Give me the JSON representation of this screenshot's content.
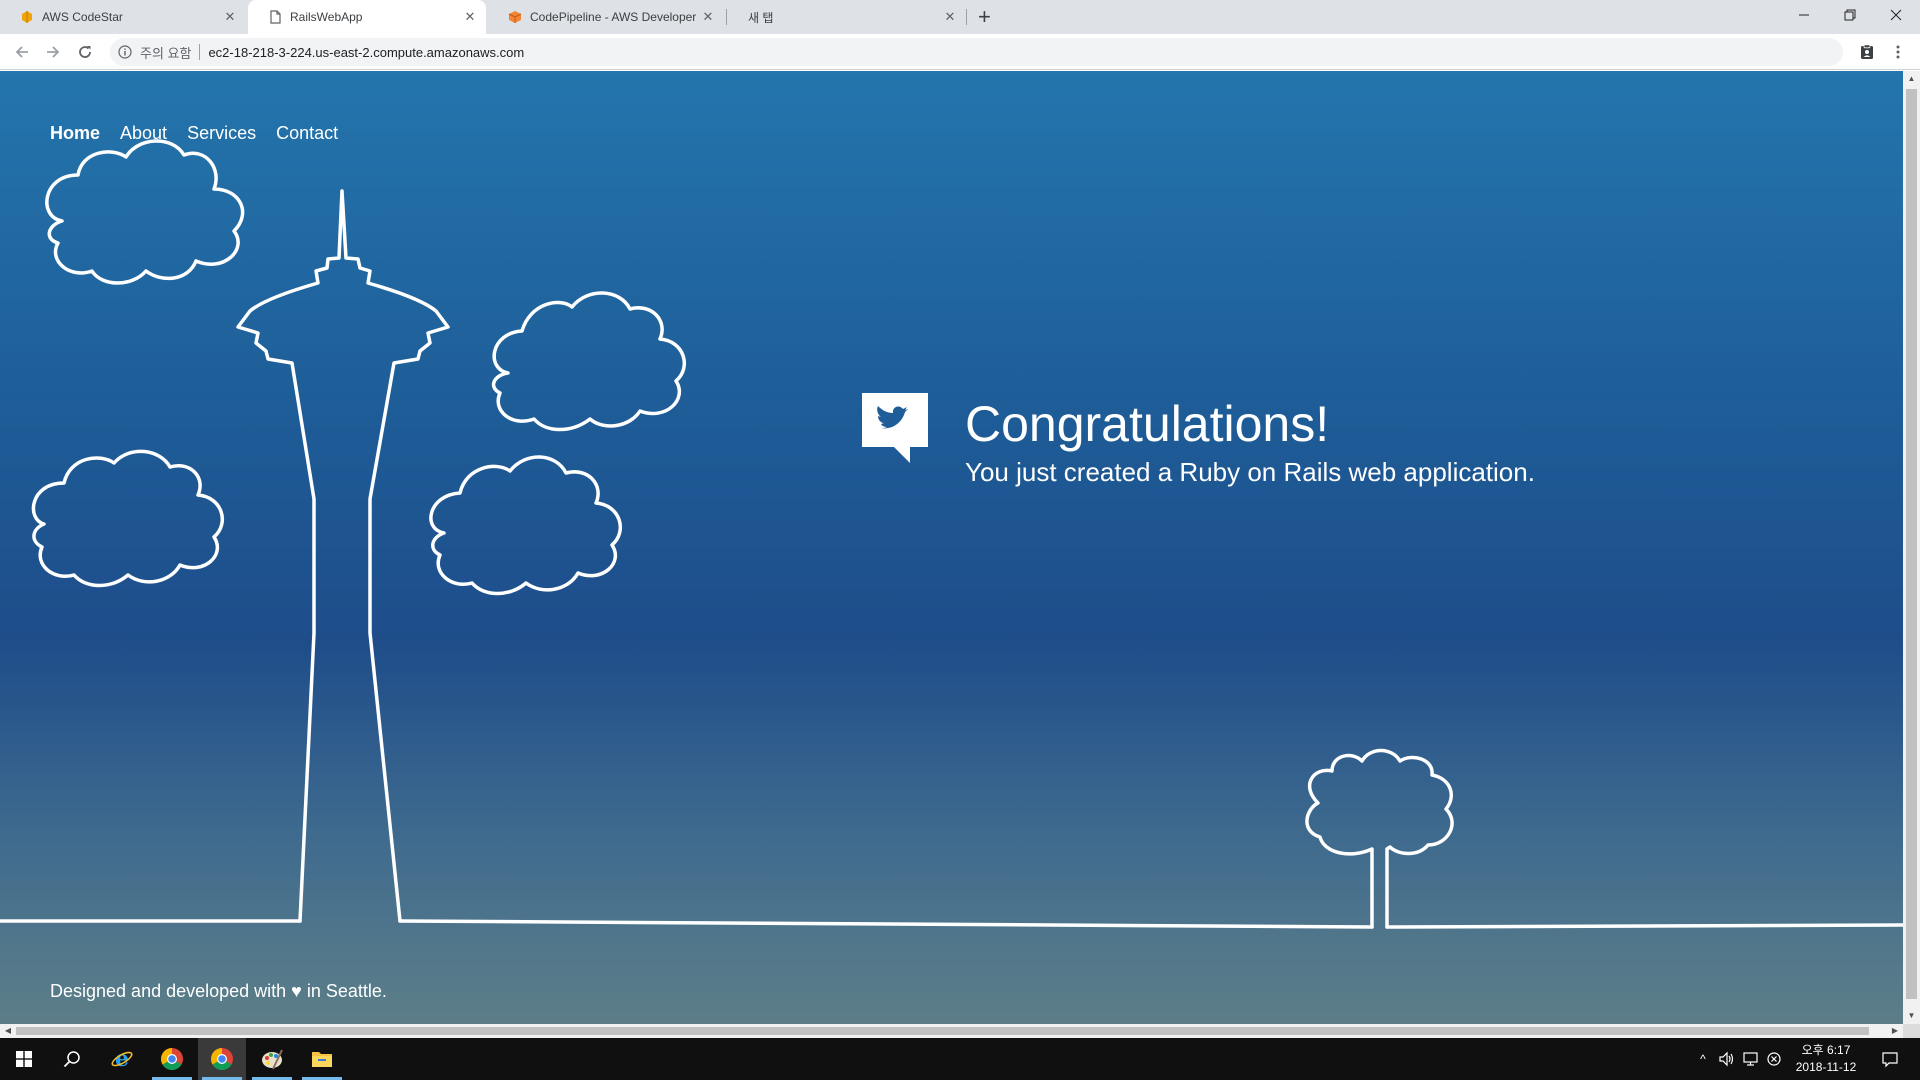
{
  "browser": {
    "tabs": [
      {
        "title": "AWS CodeStar",
        "active": false
      },
      {
        "title": "RailsWebApp",
        "active": true
      },
      {
        "title": "CodePipeline - AWS Developer",
        "active": false
      },
      {
        "title": "새 탭",
        "active": false
      }
    ],
    "address_bar": {
      "security_label": "주의 요함",
      "url": "ec2-18-218-3-224.us-east-2.compute.amazonaws.com"
    }
  },
  "page": {
    "nav": [
      {
        "label": "Home",
        "active": true
      },
      {
        "label": "About"
      },
      {
        "label": "Services"
      },
      {
        "label": "Contact"
      }
    ],
    "hero": {
      "title": "Congratulations!",
      "subtitle": "You just created a Ruby on Rails web application."
    },
    "footer": "Designed and developed with ♥ in Seattle."
  },
  "taskbar": {
    "clock": {
      "time": "오후 6:17",
      "date": "2018-11-12"
    }
  },
  "colors": {
    "gradient_top": "#2475ad",
    "gradient_mid": "#1e4d8a",
    "gradient_bottom": "#5c7d88",
    "line_art": "#ffffff"
  }
}
